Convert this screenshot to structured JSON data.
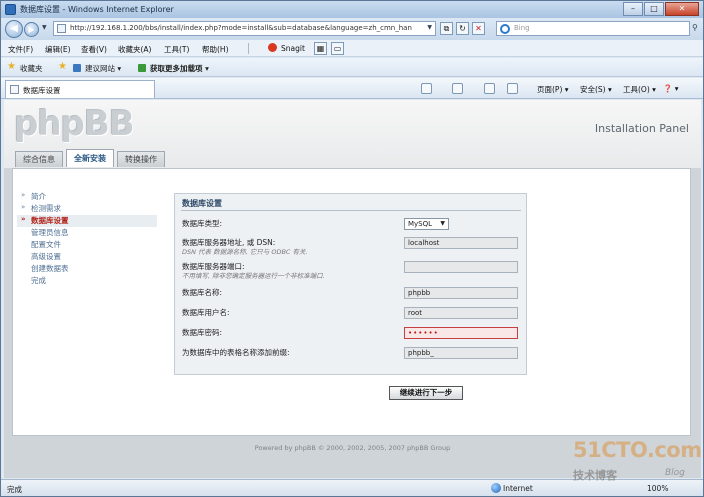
{
  "window": {
    "title": "数据库设置 - Windows Internet Explorer",
    "minimize": "–",
    "maximize": "□",
    "close": "✕"
  },
  "address": {
    "url": "http://192.168.1.200/bbs/install/index.php?mode=install&sub=database&language=zh_cmn_han",
    "search_placeholder": "Bing"
  },
  "menu": {
    "items": [
      "文件(F)",
      "编辑(E)",
      "查看(V)",
      "收藏夹(A)",
      "工具(T)",
      "帮助(H)"
    ],
    "snagit": "Snagit"
  },
  "favorites": {
    "label": "收藏夹",
    "items": [
      "建议网站 ▾",
      "获取更多加载项 ▾"
    ]
  },
  "ie_tab": {
    "title": "数据库设置"
  },
  "commands": {
    "page": "页面(P) ▾",
    "safety": "安全(S) ▾",
    "tools": "工具(O) ▾",
    "help": "❓ ▾"
  },
  "header": {
    "logo": "phpBB",
    "panel_title": "Installation Panel",
    "tabs": [
      "综合信息",
      "全新安装",
      "转换操作"
    ],
    "active_tab": 1
  },
  "sidenav": {
    "items": [
      {
        "label": "简介",
        "state": "done"
      },
      {
        "label": "检测需求",
        "state": "done"
      },
      {
        "label": "数据库设置",
        "state": "current"
      },
      {
        "label": "管理员信息",
        "state": "pending"
      },
      {
        "label": "配置文件",
        "state": "pending"
      },
      {
        "label": "高级设置",
        "state": "pending"
      },
      {
        "label": "创建数据表",
        "state": "pending"
      },
      {
        "label": "完成",
        "state": "pending"
      }
    ]
  },
  "form": {
    "legend": "数据库设置",
    "db_type": {
      "label": "数据库类型:",
      "value": "MySQL"
    },
    "host": {
      "label": "数据库服务器地址, 或 DSN:",
      "hint": "DSN 代表 数据源名称, 它只与 ODBC 有关.",
      "value": "localhost"
    },
    "port": {
      "label": "数据库服务器端口:",
      "hint": "不用填写, 除非您确定服务器运行一个非标准端口.",
      "value": ""
    },
    "name": {
      "label": "数据库名称:",
      "value": "phpbb"
    },
    "user": {
      "label": "数据库用户名:",
      "value": "root"
    },
    "password": {
      "label": "数据库密码:",
      "value": "••••••"
    },
    "prefix": {
      "label": "为数据库中的表格名称添加前缀:",
      "value": "phpbb_"
    },
    "submit": "继续进行下一步"
  },
  "footer": {
    "text": "Powered by phpBB © 2000, 2002, 2005, 2007 phpBB Group"
  },
  "status": {
    "left": "完成",
    "zone": "Internet",
    "zoom": "100%"
  },
  "watermark": {
    "site": "51CTO.com",
    "sub": "技术博客",
    "blog": "Blog"
  }
}
